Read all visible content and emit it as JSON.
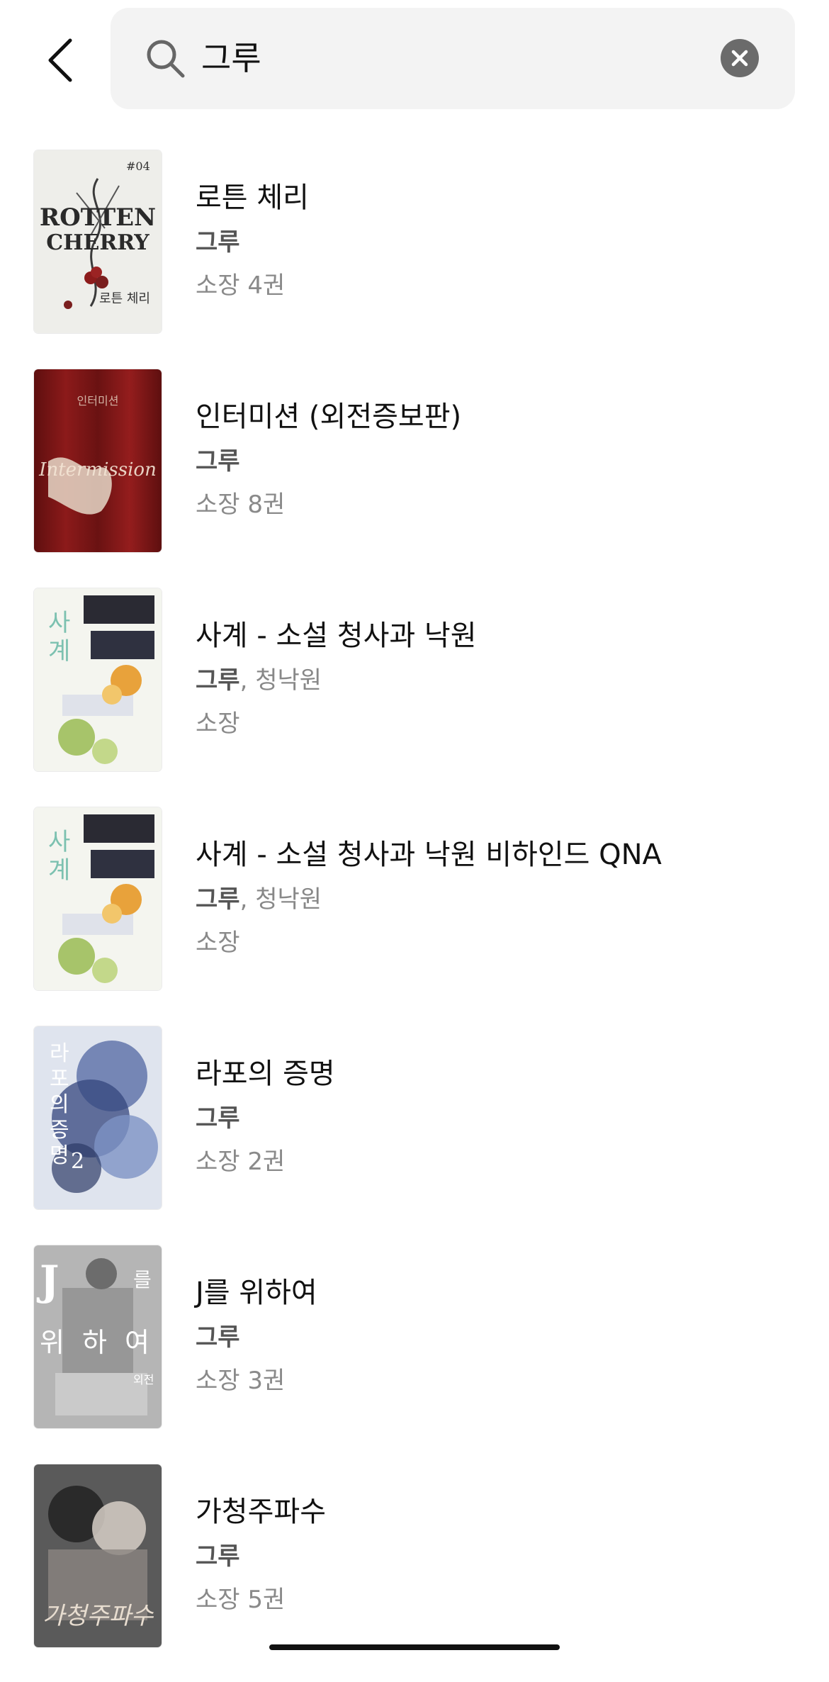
{
  "search": {
    "query": "그루"
  },
  "results": [
    {
      "title": "로튼 체리",
      "author": "그루",
      "co_author": "",
      "owned": "소장 4권",
      "cover": {
        "text": "ROTTEN CHERRY",
        "sub": "로튼 체리",
        "bg": "#eeeeea",
        "accent": "#7a1e1e"
      }
    },
    {
      "title": "인터미션 (외전증보판)",
      "author": "그루",
      "co_author": "",
      "owned": "소장 8권",
      "cover": {
        "text": "",
        "sub": "",
        "bg": "#7a1616",
        "accent": "#e6d8c8"
      }
    },
    {
      "title": "사계 - 소설 청사과 낙원",
      "author": "그루",
      "co_author": "청낙원",
      "owned": "소장",
      "cover": {
        "text": "사계",
        "sub": "",
        "bg": "#f4f5ef",
        "accent": "#e8a23b"
      }
    },
    {
      "title": "사계 - 소설 청사과 낙원 비하인드 QNA",
      "author": "그루",
      "co_author": "청낙원",
      "owned": "소장",
      "cover": {
        "text": "사계",
        "sub": "",
        "bg": "#f4f5ef",
        "accent": "#e8a23b"
      }
    },
    {
      "title": "라포의 증명",
      "author": "그루",
      "co_author": "",
      "owned": "소장 2권",
      "cover": {
        "text": "라포의 증명 2",
        "sub": "",
        "bg": "#6c80b4",
        "accent": "#ffffff"
      }
    },
    {
      "title": "J를 위하여",
      "author": "그루",
      "co_author": "",
      "owned": "소장 3권",
      "cover": {
        "text": "J를 위하여",
        "sub": "외전",
        "bg": "#9a9a9a",
        "accent": "#ffffff"
      }
    },
    {
      "title": "가청주파수",
      "author": "그루",
      "co_author": "",
      "owned": "소장 5권",
      "cover": {
        "text": "가청주파수",
        "sub": "",
        "bg": "#4a4a4a",
        "accent": "#e8ddd0"
      }
    }
  ],
  "icons": {
    "back": "chevron-left-icon",
    "search": "search-icon",
    "clear": "clear-circle-icon"
  },
  "colors": {
    "search_bg": "#f3f3f3",
    "clear_icon_bg": "#6b6b6b"
  }
}
